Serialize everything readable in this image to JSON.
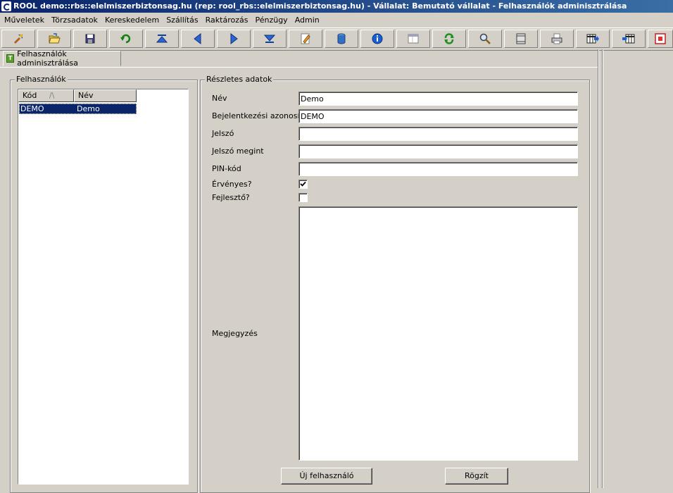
{
  "window": {
    "title": "ROOL demo::rbs::elelmiszerbiztonsag.hu (rep: rool_rbs::elelmiszerbiztonsag.hu) - Vállalat: Bemutató vállalat - Felhasználók adminisztrálása"
  },
  "menu": [
    "Műveletek",
    "Törzsadatok",
    "Kereskedelem",
    "Szállítás",
    "Raktározás",
    "Pénzügy",
    "Admin"
  ],
  "toolbar": [
    {
      "icon": "tools-icon"
    },
    {
      "icon": "open-folder-icon"
    },
    {
      "icon": "save-icon"
    },
    {
      "icon": "undo-icon"
    },
    {
      "icon": "first-record-icon"
    },
    {
      "icon": "previous-record-icon"
    },
    {
      "icon": "next-record-icon"
    },
    {
      "icon": "last-record-icon"
    },
    {
      "icon": "edit-icon"
    },
    {
      "icon": "database-icon"
    },
    {
      "icon": "info-icon"
    },
    {
      "icon": "window-icon"
    },
    {
      "icon": "refresh-icon"
    },
    {
      "icon": "search-icon"
    },
    {
      "icon": "layout-icon"
    },
    {
      "icon": "print-icon"
    },
    {
      "icon": "grid-export-icon"
    },
    {
      "icon": "grid-import-icon"
    },
    {
      "icon": "close-form-icon"
    }
  ],
  "tab": {
    "label": "Felhasználók adminisztrálása",
    "icon_letter": "T"
  },
  "users": {
    "title": "Felhasználók",
    "columns": [
      "Kód",
      "Név"
    ],
    "sort_indicator": "/\\",
    "rows": [
      {
        "kod": "DEMO",
        "nev": "Demo"
      }
    ]
  },
  "details": {
    "title": "Részletes adatok",
    "nev_label": "Név",
    "nev_value": "Demo",
    "login_label": "Bejelentkezési azonosító",
    "login_value": "DEMO",
    "jelszo_label": "Jelszó",
    "jelszo_value": "",
    "jelszo2_label": "Jelszó megint",
    "jelszo2_value": "",
    "pin_label": "PIN-kód",
    "pin_value": "",
    "ervenyes_label": "Érvényes?",
    "ervenyes_checked": true,
    "fejleszto_label": "Fejlesztő?",
    "fejleszto_checked": false,
    "megjegyzes_label": "Megjegyzés",
    "megjegyzes_value": ""
  },
  "buttons": {
    "new_user": "Új felhasználó",
    "save": "Rögzít"
  }
}
